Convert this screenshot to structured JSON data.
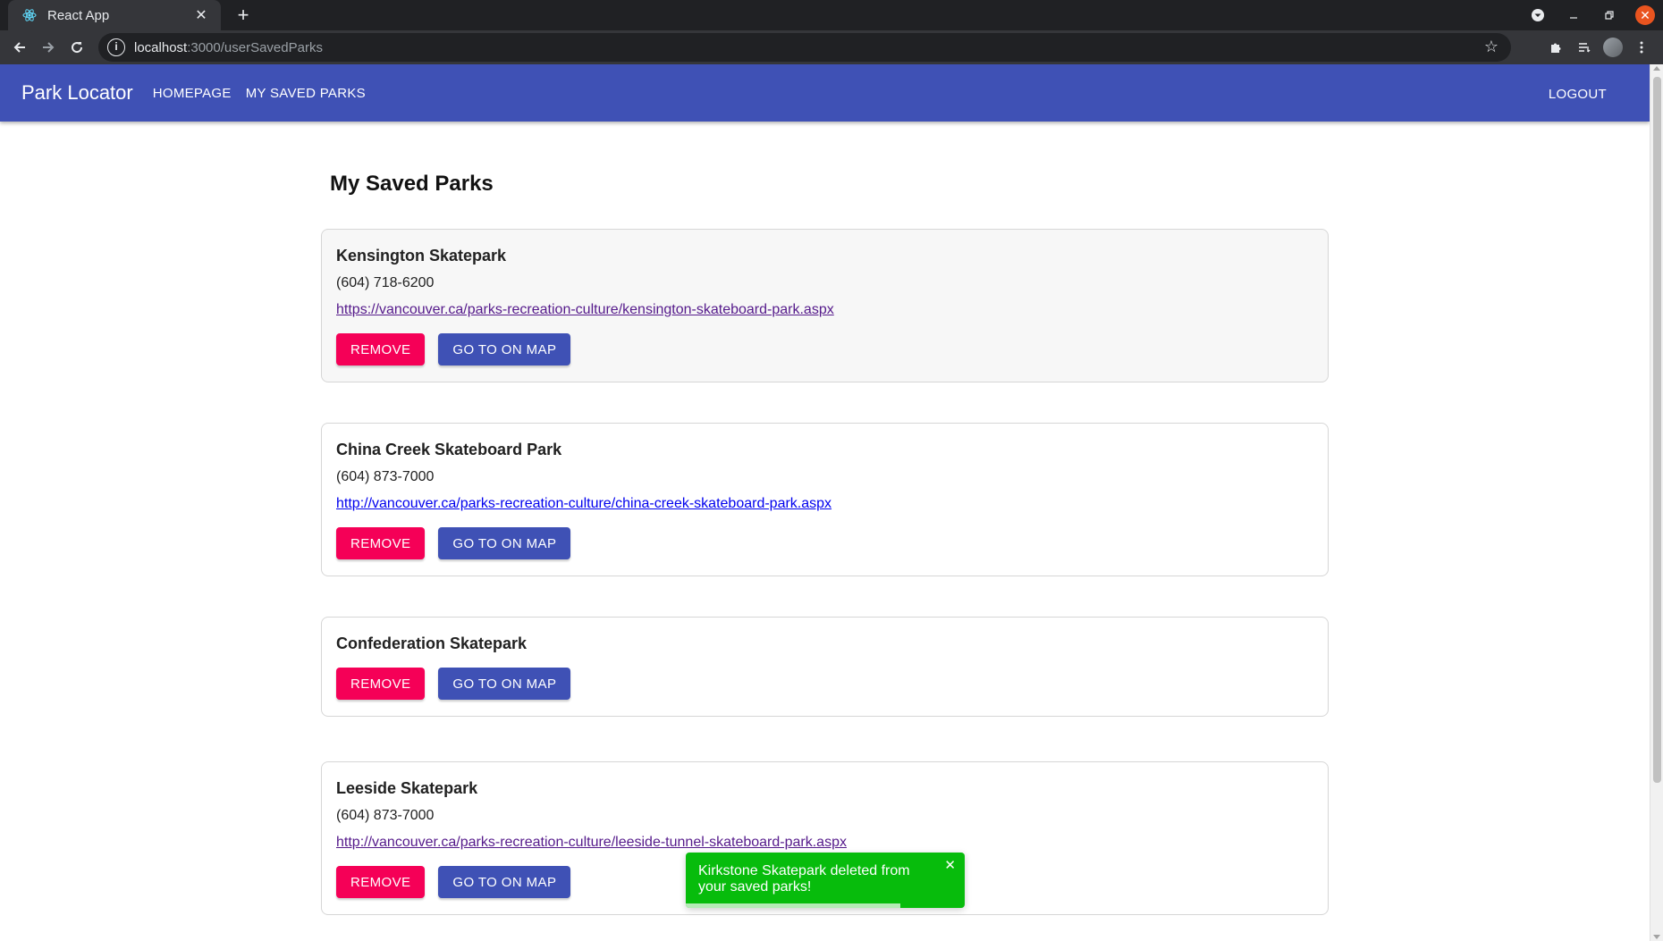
{
  "browser": {
    "tab_title": "React App",
    "tab_close": "✕",
    "new_tab": "+",
    "url_host": "localhost",
    "url_path": ":3000/userSavedParks"
  },
  "app": {
    "brand": "Park Locator",
    "nav": [
      "HOMEPAGE",
      "MY SAVED PARKS"
    ],
    "logout": "LOGOUT",
    "accent_color": "#3f51b5",
    "remove_color": "#f50057"
  },
  "page": {
    "title": "My Saved Parks"
  },
  "parks": [
    {
      "name": "Kensington Skatepark",
      "phone": "(604) 718-6200",
      "url": "https://vancouver.ca/parks-recreation-culture/kensington-skateboard-park.aspx"
    },
    {
      "name": "China Creek Skateboard Park",
      "phone": "(604) 873-7000",
      "url": "http://vancouver.ca/parks-recreation-culture/china-creek-skateboard-park.aspx"
    },
    {
      "name": "Confederation Skatepark"
    },
    {
      "name": "Leeside Skatepark",
      "phone": "(604) 873-7000",
      "url": "http://vancouver.ca/parks-recreation-culture/leeside-tunnel-skateboard-park.aspx"
    }
  ],
  "buttons": {
    "remove": "REMOVE",
    "go_to_map": "GO TO ON MAP"
  },
  "toast": {
    "message": "Kirkstone Skatepark deleted from your saved parks!",
    "close": "✕",
    "color": "#07bc0c",
    "progress": 0.77
  }
}
